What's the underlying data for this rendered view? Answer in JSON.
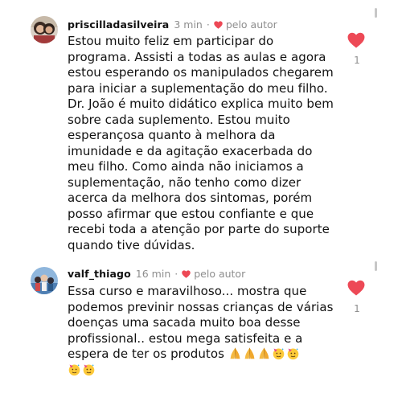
{
  "comments": [
    {
      "username": "priscilladasilveira",
      "time": "3 min",
      "separator": "·",
      "author_label": "pelo autor",
      "like_count": "1",
      "lines": [
        "Estou muito feliz em participar do",
        "programa. Assisti a todas as aulas e agora",
        "estou esperando os manipulados chegarem",
        "para iniciar a suplementação do meu filho.",
        "Dr. João é muito didático explica muito bem",
        "sobre cada suplemento. Estou muito",
        "esperançosa quanto à melhora da",
        "imunidade e da agitação exacerbada do",
        "meu filho. Como ainda não iniciamos a",
        "suplementação, não tenho como dizer",
        "acerca da melhora dos sintomas, porém",
        "posso afirmar que estou confiante e que",
        "recebi toda a atenção por parte do suporte",
        "quando tive dúvidas."
      ]
    },
    {
      "username": "valf_thiago",
      "time": "16 min",
      "separator": "·",
      "author_label": "pelo autor",
      "like_count": "1",
      "lines": [
        "Essa curso e maravilhoso... mostra que",
        "podemos previnir nossas crianças de várias",
        "doenças uma sacada muito boa desse",
        "profissional.. estou mega satisfeita e a"
      ],
      "last_line_text": "espera de ter os produtos",
      "emojis": [
        "folded-hands",
        "folded-hands",
        "folded-hands",
        "partying-face",
        "partying-face",
        "partying-face",
        "partying-face"
      ]
    }
  ],
  "colors": {
    "like_red": "#ed4956",
    "meta_gray": "#8e8e8e",
    "text": "#111111"
  }
}
